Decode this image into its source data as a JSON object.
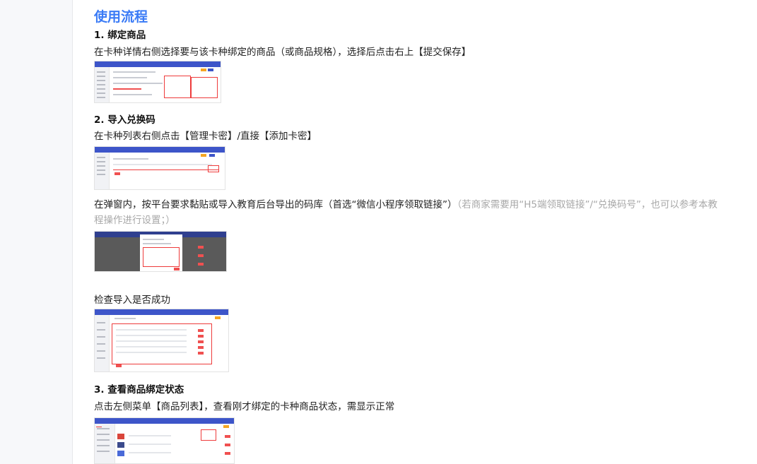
{
  "title": "使用流程",
  "steps": [
    {
      "heading": "1. 绑定商品",
      "text": "在卡种详情右侧选择要与该卡种绑定的商品（或商品规格），选择后点击右上【提交保存】",
      "image": "bind-product-screenshot"
    },
    {
      "heading": "2. 导入兑换码",
      "text": "在卡种列表右侧点击【管理卡密】/直接【添加卡密】",
      "image": "card-list-screenshot",
      "text2": "在弹窗内，按平台要求黏贴或导入教育后台导出的码库（首选“微信小程序领取链接”）",
      "text2_note": "（若商家需要用“H5端领取链接”/“兑换码号”，也可以参考本教程操作进行设置；）",
      "image2": "import-dialog-screenshot",
      "text3": "检查导入是否成功",
      "image3": "import-result-screenshot"
    },
    {
      "heading": "3. 查看商品绑定状态",
      "text": "点击左侧菜单【商品列表】，查看刚才绑定的卡种商品状态，需显示正常",
      "image": "product-list-screenshot"
    }
  ],
  "colors": {
    "title": "#3a7bf6",
    "highlight": "#ee3b3b",
    "brand_bar": "#3d55c9",
    "muted": "#a8a8a8"
  }
}
